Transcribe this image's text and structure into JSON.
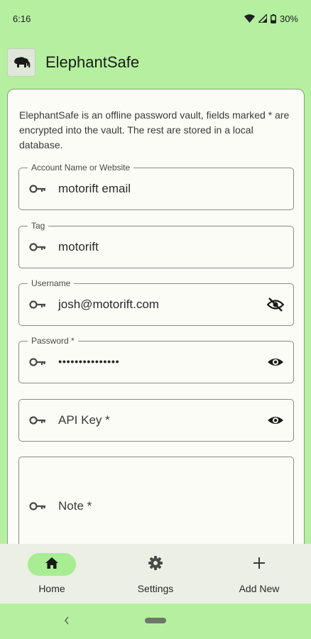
{
  "status_bar": {
    "time": "6:16",
    "battery": "30%",
    "icons": [
      "wifi-icon",
      "signal-icon",
      "battery-icon"
    ]
  },
  "app_bar": {
    "title": "ElephantSafe",
    "logo_icon": "elephant-icon"
  },
  "form": {
    "intro": "ElephantSafe is an offline password vault, fields marked * are encrypted into the vault. The rest are stored in a local database.",
    "fields": [
      {
        "label": "Account Name or Website",
        "value": "motorift email",
        "icon": "key-icon"
      },
      {
        "label": "Tag",
        "value": "motorift",
        "icon": "key-icon"
      },
      {
        "label": "Username",
        "value": "josh@motorift.com",
        "icon": "key-icon",
        "toggle": "eye-off-icon"
      },
      {
        "label": "Password *",
        "value": "•••••••••••••••",
        "icon": "key-icon",
        "toggle": "eye-icon"
      },
      {
        "label": "",
        "placeholder": "API Key *",
        "icon": "key-icon",
        "toggle": "eye-icon"
      },
      {
        "label": "",
        "placeholder": "Note *",
        "icon": "key-icon"
      }
    ]
  },
  "bottom_nav": {
    "items": [
      {
        "label": "Home",
        "icon": "home-icon",
        "active": true
      },
      {
        "label": "Settings",
        "icon": "gear-icon",
        "active": false
      },
      {
        "label": "Add New",
        "icon": "plus-icon",
        "active": false
      }
    ]
  },
  "colors": {
    "background": "#b4f0a0",
    "card": "#fcfcf6",
    "nav_bar": "#ecefe4",
    "active_pill": "#a8ec94"
  }
}
